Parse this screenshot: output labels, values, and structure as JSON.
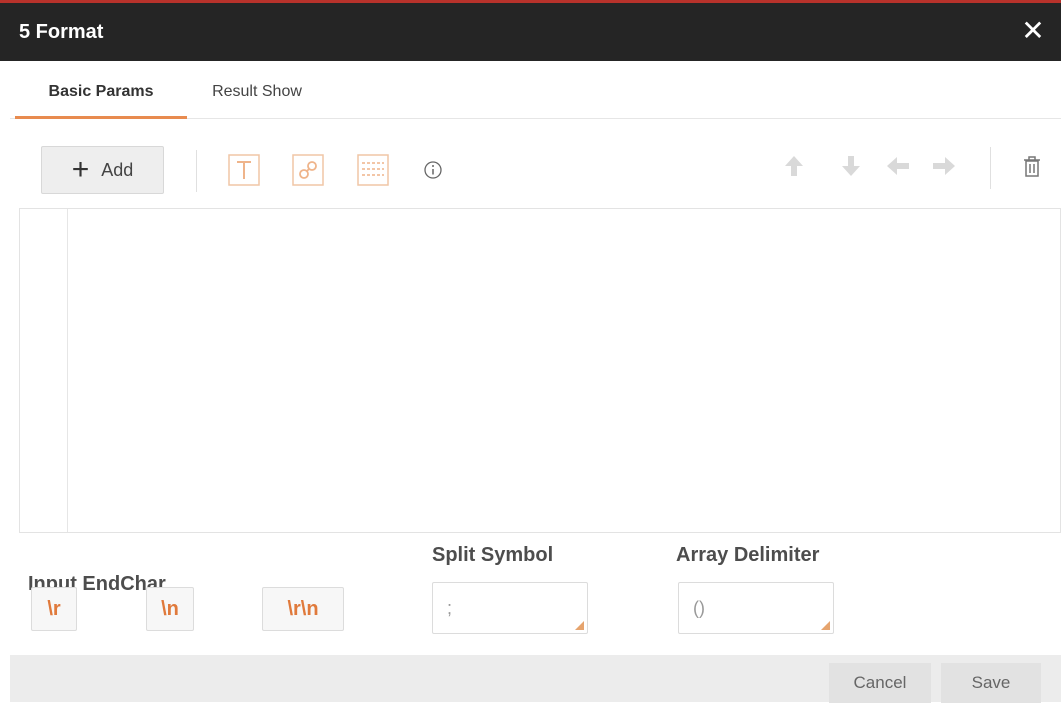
{
  "dialog": {
    "title": "5 Format",
    "close_label": "✕"
  },
  "tabs": [
    {
      "label": "Basic Params",
      "active": true
    },
    {
      "label": "Result Show",
      "active": false
    }
  ],
  "toolbar": {
    "add_label": "Add",
    "icons": [
      "text-icon",
      "link-icon",
      "grid-icon",
      "info-icon",
      "arrow-up-icon",
      "arrow-down-icon",
      "arrow-left-icon",
      "arrow-right-icon",
      "delete-icon"
    ]
  },
  "editor": {
    "content": ""
  },
  "input_endchar": {
    "label": "Input EndChar",
    "buttons": [
      "\\r",
      "\\n",
      "\\r\\n"
    ]
  },
  "split_symbol": {
    "label": "Split Symbol",
    "value": ";"
  },
  "array_delimiter": {
    "label": "Array Delimiter",
    "value": "()"
  },
  "footer": {
    "cancel_label": "Cancel",
    "save_label": "Save"
  },
  "colors": {
    "title_bar": "#252525",
    "title_accent": "#b8322b",
    "tab_accent": "#e88b4f",
    "endchar_text": "#e07a3c"
  }
}
